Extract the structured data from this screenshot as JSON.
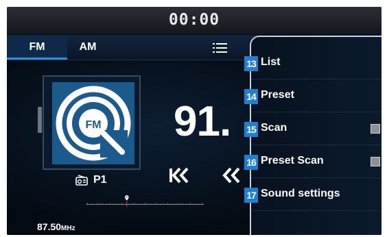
{
  "status_bar": {
    "time": "00:00"
  },
  "tabs": [
    {
      "label": "FM"
    },
    {
      "label": "AM"
    }
  ],
  "station": {
    "logo_text": "FM",
    "preset": "P1",
    "frequency_large": "91.",
    "frequency_value": "87.50",
    "frequency_unit": "MHz"
  },
  "menu": {
    "items": [
      {
        "badge": "13",
        "label": "List",
        "has_checkbox": false
      },
      {
        "badge": "14",
        "label": "Preset",
        "has_checkbox": false
      },
      {
        "badge": "15",
        "label": "Scan",
        "has_checkbox": true
      },
      {
        "badge": "16",
        "label": "Preset Scan",
        "has_checkbox": true
      },
      {
        "badge": "17",
        "label": "Sound settings",
        "has_checkbox": false
      }
    ]
  },
  "colors": {
    "accent": "#2a8fe0",
    "badge": "#1f7fd0",
    "tuner_marker": "#e03030"
  },
  "icons": [
    "list-icon",
    "radio-icon",
    "skip-back-icon",
    "seek-back-icon",
    "fm-logo-icon",
    "location-pin-icon"
  ]
}
